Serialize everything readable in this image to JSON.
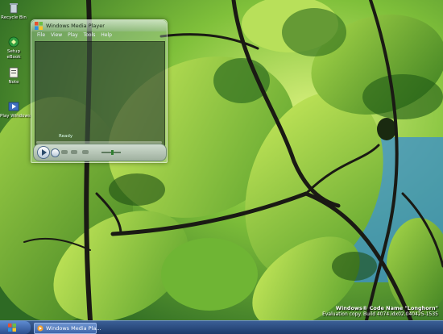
{
  "desktop": {
    "icons": [
      {
        "label": "Recycle Bin",
        "icon": "recycle-bin-icon"
      },
      {
        "label": "Setup",
        "sublabel": "eBook",
        "icon": "setup-icon"
      },
      {
        "label": "Note",
        "icon": "note-icon"
      },
      {
        "label": "Play Windows",
        "icon": "media-icon"
      }
    ]
  },
  "media_player": {
    "title": "Windows Media Player",
    "menu": [
      "File",
      "View",
      "Play",
      "Tools",
      "Help"
    ],
    "status": "Ready"
  },
  "watermark": {
    "line1": "Windows® Code Name \"Longhorn\"",
    "line2": "Evaluation copy. Build 4074.idx02.040425-1535"
  },
  "taskbar": {
    "task_button_label": "Windows Media Pla..."
  }
}
